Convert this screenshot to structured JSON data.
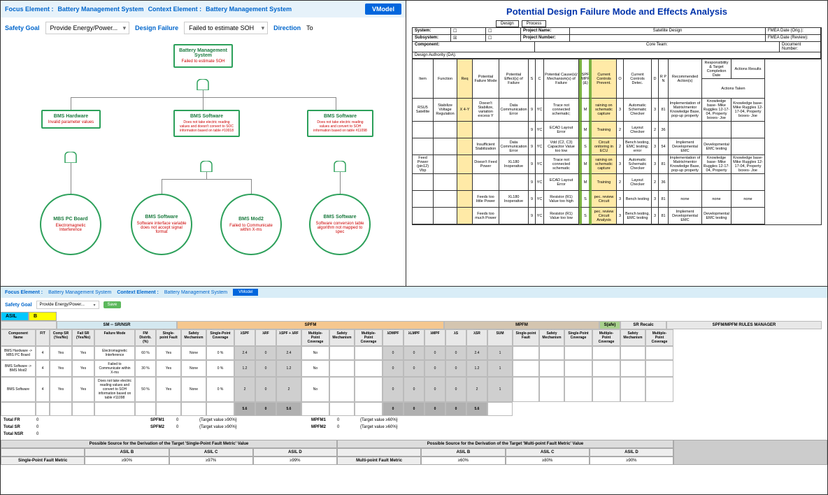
{
  "top_left": {
    "focus_label": "Focus Element :",
    "focus_value": "Battery Management System",
    "context_label": "Context Element :",
    "context_value": "Battery Management System",
    "vmodel": "VModel",
    "safety_goal_label": "Safety Goal",
    "safety_goal_value": "Provide Energy/Power...",
    "design_failure_label": "Design Failure",
    "design_failure_value": "Failed to estimate SOH",
    "direction_label": "Direction",
    "direction_value": "To"
  },
  "tree": {
    "root": {
      "title": "Battery Management System",
      "fail": "Failed to estimate SOH"
    },
    "l2_bms_hw": {
      "title": "BMS Hardware",
      "fail": "Invalid parameter values"
    },
    "l2_bms_sw1": {
      "title": "BMS Software",
      "fail": "Does not take electric reading values and doesn't convert to SOC information based on table #10018"
    },
    "l2_bms_sw2": {
      "title": "BMS Software",
      "fail": "Does not take electric reading values and convert to SOH information based on table #11098"
    },
    "c1": {
      "title": "MBS PC Board",
      "fail": "Electromagnetic Interference"
    },
    "c2": {
      "title": "BMS Software",
      "fail": "Software interface variable does not accept signal format"
    },
    "c3": {
      "title": "BMS Mod2",
      "fail": "Failed to Communicate within X-ms"
    },
    "c4": {
      "title": "BMS Software",
      "fail": "Software conversion table algorithm not mapped to spec"
    }
  },
  "fmea": {
    "title": "Potential Design Failure Mode and Effects Analysis",
    "btn_design": "Design",
    "btn_process": "Process",
    "hdr": {
      "system": "System:",
      "subsystem": "Subsystem:",
      "component": "Component:",
      "design_authority": "Design Authority (DA):",
      "project_name": "Project Name:",
      "project_number": "Project Number:",
      "core_team": "Core Team:",
      "satellite_design": "Satellite Design",
      "fmea_date_orig": "FMEA Date (Orig.):",
      "fmea_date_review": "FMEA Date (Review):",
      "document_number": "Document Number:"
    },
    "cols": [
      "Item",
      "Function",
      "Req",
      "Potential Failure Mode",
      "Potential Effect(s) of Failure",
      "S",
      "C",
      "Potential Cause(s)/ Mechanism(s) of Failure",
      "SPF MPF (&)",
      "Current Controls Prevent.",
      "O",
      "Current Controls Detec.",
      "D",
      "R P N",
      "Recommended Action(s)",
      "Responsibility & Target Completion Date",
      "Actions Results",
      "Actions Taken"
    ],
    "rows": [
      {
        "item": "RSU5 Satellite",
        "func": "Stabilize Voltage Regulation",
        "req": "X 4-Y",
        "mode": "Doesn't Stabilize, variation excess Y",
        "effect": "Data Communication Error",
        "s": "9",
        "c": "YC",
        "cause": "Trace not connected schematic;",
        "spf": "M",
        "prevent": "raining on schematic capture",
        "o": "3",
        "detec": "Automatic Schematic Checker",
        "d": "3",
        "rpn": "81",
        "rec": "Implementation of Matrix/mentor Knowledge Base, pop-up property",
        "resp": "Knowledge base- Mike Ruggles 12-17-04, Property boxes- Joe",
        "taken": "Knowledge base- Mike Ruggles 12-17-04, Property boxes- Joe"
      },
      {
        "item": "",
        "func": "",
        "req": "",
        "mode": "",
        "effect": "",
        "s": "9",
        "c": "YC",
        "cause": "ECAD Layout Error",
        "spf": "M",
        "prevent": "Training",
        "o": "2",
        "detec": "Layout Checker",
        "d": "2",
        "rpn": "36",
        "rec": "",
        "resp": "",
        "taken": ""
      },
      {
        "item": "",
        "func": "",
        "req": "",
        "mode": "Insufficient Stabilization",
        "effect": "Data Communication Error",
        "s": "9",
        "c": "YC",
        "cause": "Vdd (C2, C3) Capacitor Value too low",
        "spf": "S",
        "prevent": "Circuit onitoring in ECU",
        "o": "2",
        "detec": "Bench testing, EMC testing; error",
        "d": "3",
        "rpn": "54",
        "rec": "Implement Developmental EMC",
        "resp": "Developmental EMC testing",
        "taken": ""
      },
      {
        "item": "Feed Power (pin12) Vbp",
        "func": "",
        "req": "",
        "mode": "Doesn't Feed Power",
        "effect": "XL180 Inoperative",
        "s": "9",
        "c": "YC",
        "cause": "Trace not connected schematic",
        "spf": "M",
        "prevent": "raining on schematic capture",
        "o": "3",
        "detec": "Automatic Schematic Checker",
        "d": "3",
        "rpn": "81",
        "rec": "Implementation of Matrix/mentor Knowledge Base, pop-up property",
        "resp": "Knowledge base- Mike Ruggles 12-17-04, Property",
        "taken": "Knowledge base- Mike Ruggles 12-17-04, Property boxes- Joe"
      },
      {
        "item": "",
        "func": "",
        "req": "",
        "mode": "",
        "effect": "",
        "s": "9",
        "c": "YC",
        "cause": "ECAD Layout Error",
        "spf": "M",
        "prevent": "Training",
        "o": "2",
        "detec": "Layout Checker",
        "d": "2",
        "rpn": "36",
        "rec": "",
        "resp": "",
        "taken": ""
      },
      {
        "item": "",
        "func": "",
        "req": "",
        "mode": "Feeds too little Power",
        "effect": "XL180 Inoperative",
        "s": "9",
        "c": "YC",
        "cause": "Resistor (R1) Value too high",
        "spf": "S",
        "prevent": "pec. review Circuit",
        "o": "3",
        "detec": "Bench testing",
        "d": "3",
        "rpn": "81",
        "rec": "none",
        "resp": "none",
        "taken": "none"
      },
      {
        "item": "",
        "func": "",
        "req": "",
        "mode": "Feeds too much Power",
        "effect": "",
        "s": "9",
        "c": "YC",
        "cause": "Resistor (R1) Value too low",
        "spf": "S",
        "prevent": "pec. review Circuit Analysis",
        "o": "3",
        "detec": "Bench testing, EMC testing",
        "d": "3",
        "rpn": "81",
        "rec": "Implement Developmental EMC",
        "resp": "Developmental EMC testing",
        "taken": ""
      }
    ]
  },
  "bottom": {
    "focus_label": "Focus Element :",
    "focus_value": "Battery Management System",
    "context_label": "Context Element :",
    "context_value": "Battery Management System",
    "vmodel": "VModel",
    "safety_goal_label": "Safety Goal",
    "safety_goal_value": "Provide Energy/Power...",
    "save": "Save",
    "asil_label": "ASIL",
    "asil_value": "B",
    "sections": {
      "sm": "SM -- SR/NSR",
      "spfm": "SPFM",
      "mpfm": "MPFM",
      "safe": "S(afe)",
      "sr": "SR Recalc",
      "rules": "SPFM/MPFM RULES MANAGER"
    },
    "cols": [
      "Component Name",
      "FIT",
      "Comp SR (Yes/No)",
      "Fail SR (Yes/No)",
      "Failure Mode",
      "FM Distrib. (%)",
      "Single-point Fault",
      "Safety Mechanism",
      "Single-Point Coverage",
      "λSPF",
      "λRF",
      "λSPF + λRF",
      "Multiple-Point Coverage",
      "Safety Mechanism",
      "Multiple-Point Coverage",
      "λDMPF",
      "λLMPF",
      "λMPF",
      "λS",
      "λSR",
      "SUM",
      "Single-point Fault",
      "Safety Mechanism",
      "Single-Point Coverage",
      "Multiple-Point Coverage",
      "Safety Mechanism",
      "Multiple-Point Coverage"
    ],
    "rows": [
      {
        "name": "BMS Hardware -> MBS PC Board",
        "fit": "4",
        "csr": "Yes",
        "fsr": "Yes",
        "mode": "Electromagnetic Interference",
        "dist": "60 %",
        "spf": "Yes",
        "sm": "None",
        "spc": "0 %",
        "aspf": "2.4",
        "arf": "0",
        "sum1": "2.4",
        "mpc": "No",
        "sm2": "",
        "mpc2": "",
        "dmpf": "0",
        "lmpf": "0",
        "ampf": "0",
        "as": "0",
        "asr": "2.4",
        "sum2": "1"
      },
      {
        "name": "BMS Software -> BMS Mod2",
        "fit": "4",
        "csr": "Yes",
        "fsr": "Yes",
        "mode": "Failed to Communicate within X-ms",
        "dist": "30 %",
        "spf": "Yes",
        "sm": "None",
        "spc": "0 %",
        "aspf": "1.2",
        "arf": "0",
        "sum1": "1.2",
        "mpc": "No",
        "sm2": "",
        "mpc2": "",
        "dmpf": "0",
        "lmpf": "0",
        "ampf": "0",
        "as": "0",
        "asr": "1.2",
        "sum2": "1"
      },
      {
        "name": "BMS Software",
        "fit": "4",
        "csr": "Yes",
        "fsr": "Yes",
        "mode": "Does not take electric reading values and convert to SOH information based on table #11098",
        "dist": "50 %",
        "spf": "Yes",
        "sm": "None",
        "spc": "0 %",
        "aspf": "2",
        "arf": "0",
        "sum1": "2",
        "mpc": "No",
        "sm2": "",
        "mpc2": "",
        "dmpf": "0",
        "lmpf": "0",
        "ampf": "0",
        "as": "0",
        "asr": "2",
        "sum2": "1"
      }
    ],
    "sums": {
      "aspf": "5.6",
      "arf": "0",
      "sum1": "5.6",
      "dmpf": "0",
      "lmpf": "0",
      "ampf": "0",
      "as": "0",
      "asr": "5.6"
    },
    "totals": [
      {
        "label": "Total FR",
        "val": "0",
        "m1": "SPFM1",
        "v1": "0",
        "t1": "{Target value ≥90%}",
        "m2": "MPFM1",
        "v2": "0",
        "t2": "{Target value ≥60%}"
      },
      {
        "label": "Total SR",
        "val": "0",
        "m1": "SPFM2",
        "v1": "0",
        "t1": "{Target value ≥90%}",
        "m2": "MPFM2",
        "v2": "0",
        "t2": "{Target value ≥60%}"
      },
      {
        "label": "Total NSR",
        "val": "0",
        "m1": "",
        "v1": "",
        "t1": "",
        "m2": "",
        "v2": "",
        "t2": ""
      }
    ],
    "deriv": {
      "sp_title": "Possible Source for the Derivation of the Target 'Single-Point Fault Metric' Value",
      "mp_title": "Possible Source for the Derivation of the Target 'Multi-point Fault Metric' Value",
      "asil_b": "ASIL B",
      "asil_c": "ASIL C",
      "asil_d": "ASIL D",
      "sp_metric": "Single-Point Fault Metric",
      "mp_metric": "Multi-point Fault Metric",
      "sp_b": "≥90%",
      "sp_c": "≥97%",
      "sp_d": "≥99%",
      "mp_b": "≥60%",
      "mp_c": "≥80%",
      "mp_d": "≥90%"
    }
  }
}
